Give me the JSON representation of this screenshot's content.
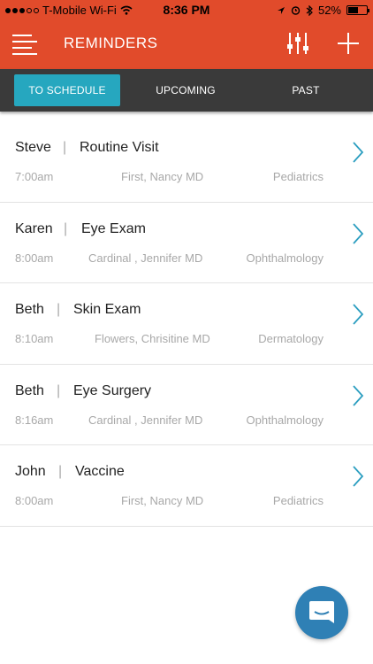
{
  "status_bar": {
    "carrier": "T-Mobile Wi-Fi",
    "time": "8:36 PM",
    "battery": "52%",
    "battery_level": 0.52
  },
  "header": {
    "title": "REMINDERS",
    "menu_icon": "hamburger-icon",
    "filter_icon": "sliders-icon",
    "add_icon": "plus-icon",
    "background": "#e14b2b"
  },
  "tabs": [
    {
      "label": "TO SCHEDULE",
      "active": true
    },
    {
      "label": "UPCOMING",
      "active": false
    },
    {
      "label": "PAST",
      "active": false
    }
  ],
  "colors": {
    "accent": "#26a7bf",
    "tabbar": "#3a3a3a",
    "chevron": "#2b9ec0",
    "fab": "#2f80b5"
  },
  "reminders": [
    {
      "patient": "Steve",
      "type": "Routine Visit",
      "time": "7:00am",
      "doctor": "First, Nancy MD",
      "department": "Pediatrics"
    },
    {
      "patient": "Karen",
      "type": "Eye Exam",
      "time": "8:00am",
      "doctor": "Cardinal , Jennifer MD",
      "department": "Ophthalmology"
    },
    {
      "patient": "Beth",
      "type": "Skin Exam",
      "time": "8:10am",
      "doctor": "Flowers, Chrisitine MD",
      "department": "Dermatology"
    },
    {
      "patient": "Beth",
      "type": "Eye Surgery",
      "time": "8:16am",
      "doctor": "Cardinal , Jennifer MD",
      "department": "Ophthalmology"
    },
    {
      "patient": "John",
      "type": "Vaccine",
      "time": "8:00am",
      "doctor": "First, Nancy MD",
      "department": "Pediatrics"
    }
  ],
  "separator": "|",
  "chat_icon": "chat-bubble-icon"
}
